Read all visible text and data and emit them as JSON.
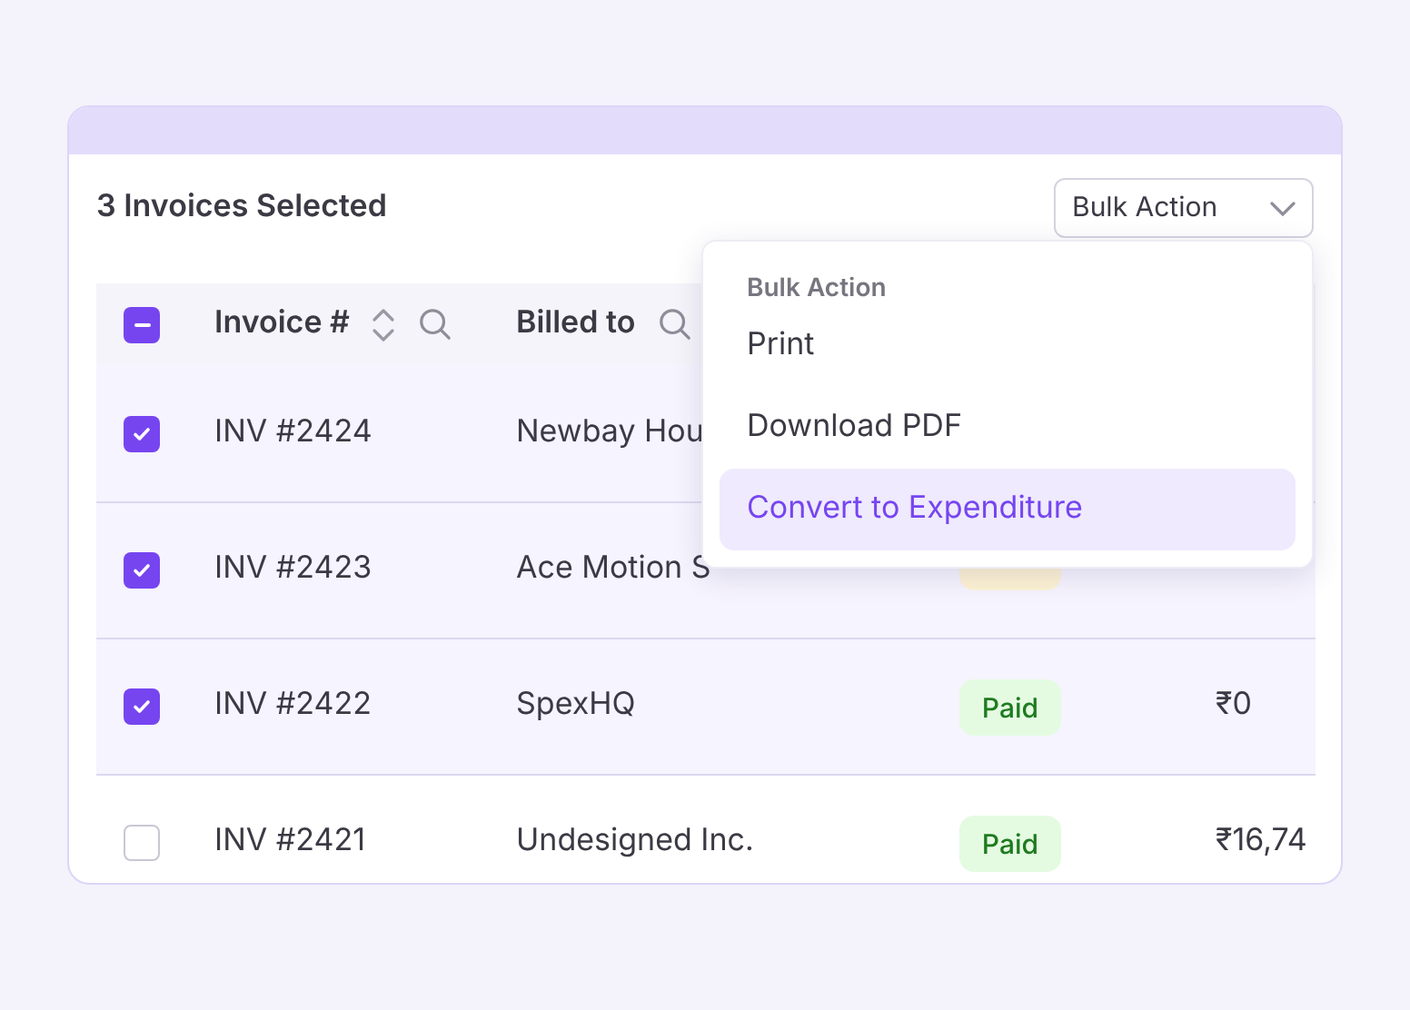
{
  "title": "3 Invoices Selected",
  "bulk_action": {
    "label": "Bulk Action",
    "expanded": true
  },
  "menu": {
    "heading": "Bulk Action",
    "items": [
      {
        "label": "Print",
        "selected": false
      },
      {
        "label": "Download PDF",
        "selected": false
      },
      {
        "label": "Convert to Expenditure",
        "selected": true
      }
    ]
  },
  "table": {
    "select_all": {
      "indeterminate": true
    },
    "columns": [
      {
        "label": "Invoice #",
        "sortable": true,
        "searchable": true
      },
      {
        "label": "Billed to",
        "sortable": false,
        "searchable": true
      }
    ],
    "rows": [
      {
        "selected": true,
        "invoice": "INV #2424",
        "billed_to": "Newbay Hou"
      },
      {
        "selected": true,
        "invoice": "INV #2423",
        "billed_to": "Ace Motion S",
        "status": {
          "kind": "pending"
        }
      },
      {
        "selected": true,
        "invoice": "INV #2422",
        "billed_to": "SpexHQ",
        "status": {
          "kind": "paid",
          "label": "Paid"
        },
        "amount": "₹0"
      },
      {
        "selected": false,
        "invoice": "INV #2421",
        "billed_to": "Undesigned Inc.",
        "status": {
          "kind": "paid",
          "label": "Paid"
        },
        "amount": "₹16,74"
      }
    ]
  }
}
